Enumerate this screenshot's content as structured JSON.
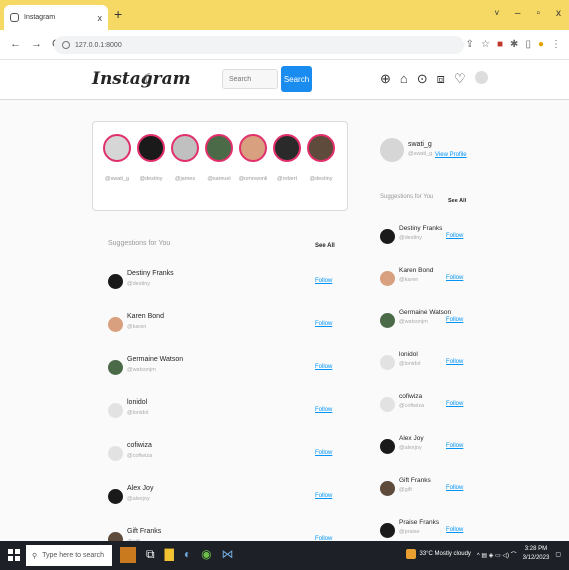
{
  "browser": {
    "tab_title": "Instagram",
    "tab_close": "x",
    "new_tab": "+",
    "url": "127.0.0.1:8000",
    "window_controls": [
      "v",
      "–",
      "▫",
      "x"
    ]
  },
  "header": {
    "logo": "Instagram",
    "search_placeholder": "Search",
    "search_button": "Search"
  },
  "stories": [
    {
      "name": "@swati_g",
      "color": "#d6d6d6"
    },
    {
      "name": "@destiny",
      "color": "#1a1a1a"
    },
    {
      "name": "@james",
      "color": "#c0c0c0"
    },
    {
      "name": "@samuel",
      "color": "#4b6b48"
    },
    {
      "name": "@omowonli",
      "color": "#d8a07e"
    },
    {
      "name": "@robert",
      "color": "#2a2a2a"
    },
    {
      "name": "@destiny",
      "color": "#5e4b3c"
    }
  ],
  "main_suggestions": {
    "title": "Suggestions for You",
    "see_all": "See All",
    "items": [
      {
        "name": "Destiny Franks",
        "user": "@destiny",
        "action": "Follow",
        "color": "#1a1a1a"
      },
      {
        "name": "Karen Bond",
        "user": "@karen",
        "action": "Follow",
        "color": "#d8a07e"
      },
      {
        "name": "Germaine Watson",
        "user": "@watsonjm",
        "action": "Follow",
        "color": "#4b6b48"
      },
      {
        "name": "lonidol",
        "user": "@lonidol",
        "action": "Follow",
        "color": "#e2e2e2"
      },
      {
        "name": "cofiwiza",
        "user": "@cofiwiza",
        "action": "Follow",
        "color": "#e2e2e2"
      },
      {
        "name": "Alex Joy",
        "user": "@alexjoy",
        "action": "Follow",
        "color": "#1a1a1a"
      },
      {
        "name": "Gift Franks",
        "user": "@gift",
        "action": "Follow",
        "color": "#5e4b3c"
      }
    ]
  },
  "sidebar": {
    "me_name": "swati_g",
    "me_user": "@swati_g",
    "view_profile": "View Profile",
    "title": "Suggestions for You",
    "see_all": "See All",
    "items": [
      {
        "name": "Destiny Franks",
        "user": "@destiny",
        "action": "Follow",
        "color": "#1a1a1a"
      },
      {
        "name": "Karen Bond",
        "user": "@karen",
        "action": "Follow",
        "color": "#d8a07e"
      },
      {
        "name": "Germaine Watson",
        "user": "@watsonjm",
        "action": "Follow",
        "color": "#4b6b48"
      },
      {
        "name": "lonidol",
        "user": "@lonidol",
        "action": "Follow",
        "color": "#e2e2e2"
      },
      {
        "name": "cofiwiza",
        "user": "@cofiwiza",
        "action": "Follow",
        "color": "#e2e2e2"
      },
      {
        "name": "Alex Joy",
        "user": "@alexjoy",
        "action": "Follow",
        "color": "#1a1a1a"
      },
      {
        "name": "Gift Franks",
        "user": "@gift",
        "action": "Follow",
        "color": "#5e4b3c"
      },
      {
        "name": "Praise Franks",
        "user": "@praise",
        "action": "Follow",
        "color": "#1a1a1a"
      }
    ]
  },
  "taskbar": {
    "search_placeholder": "Type here to search",
    "weather": "33°C Mostly cloudy",
    "time": "3:28 PM",
    "date": "3/12/2023"
  },
  "colors": {
    "accent": "#1a8cf0",
    "link": "#0095f6",
    "tab_bar": "#f6d865",
    "story_ring": "#e1306c"
  }
}
